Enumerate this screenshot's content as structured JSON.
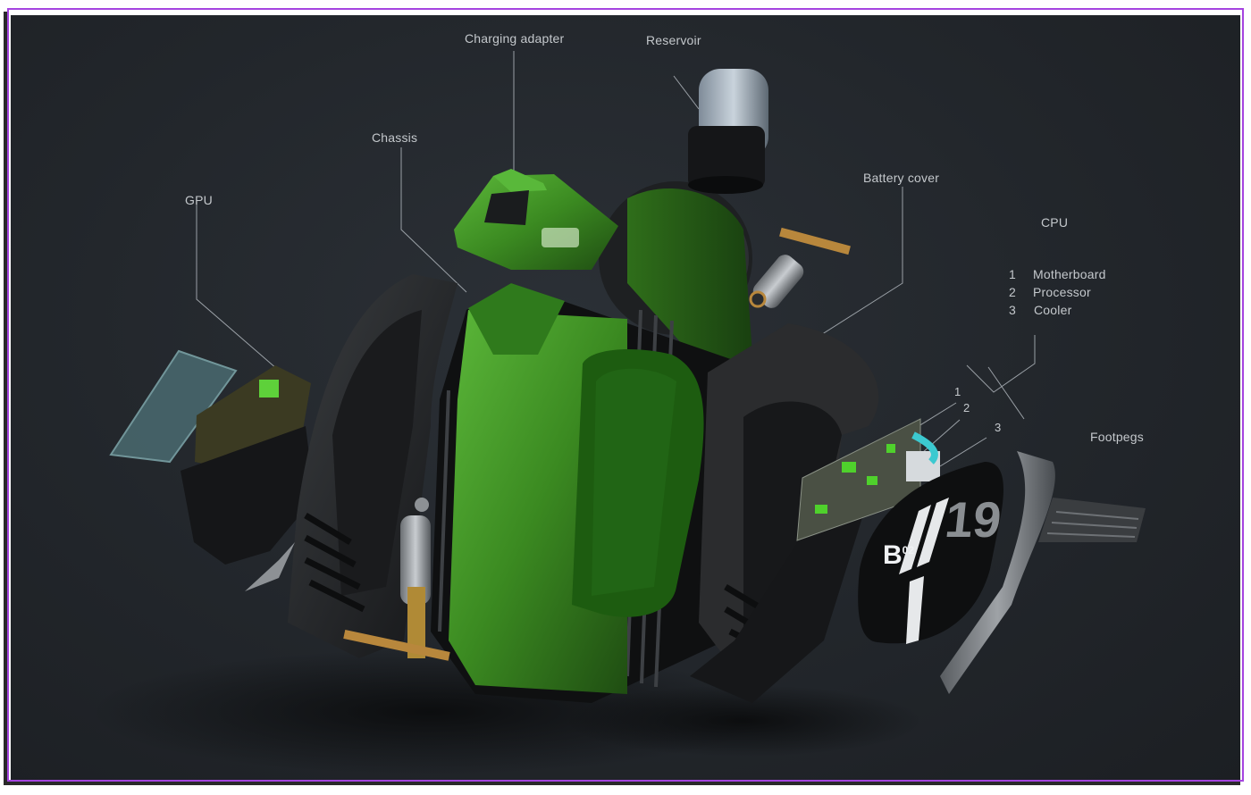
{
  "labels": {
    "charging_adapter": "Charging adapter",
    "reservoir": "Reservoir",
    "chassis": "Chassis",
    "battery_cover": "Battery cover",
    "gpu": "GPU",
    "cpu": "CPU",
    "footpegs": "Footpegs"
  },
  "cpu_list": [
    {
      "num": "1",
      "name": "Motherboard"
    },
    {
      "num": "2",
      "name": "Processor"
    },
    {
      "num": "3",
      "name": "Cooler"
    }
  ],
  "callouts": [
    "1",
    "2",
    "3"
  ],
  "battery_plate": {
    "letter": "B",
    "sup": "02",
    "number": "19"
  },
  "colors": {
    "frame": "#a544e0",
    "background": "#22262b",
    "accent_green": "#3f8f22",
    "label_text": "#c4c8cc"
  }
}
